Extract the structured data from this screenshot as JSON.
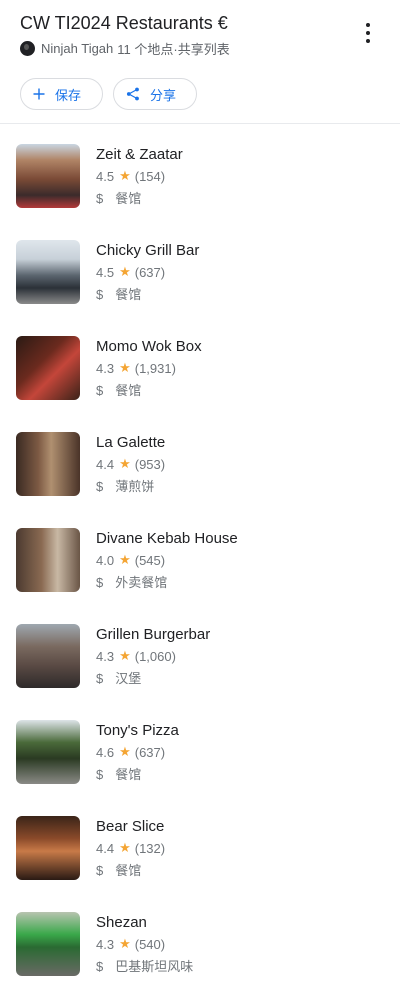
{
  "header": {
    "title": "CW TI2024 Restaurants €",
    "owner": "Ninjah Tigah",
    "meta": "11 个地点·共享列表",
    "save_label": "保存",
    "share_label": "分享"
  },
  "colors": {
    "accent": "#1a73e8",
    "star": "#f4a534"
  },
  "places": [
    {
      "name": "Zeit & Zaatar",
      "rating": "4.5",
      "reviews": "(154)",
      "price": "$",
      "category": "餐馆"
    },
    {
      "name": "Chicky Grill Bar",
      "rating": "4.5",
      "reviews": "(637)",
      "price": "$",
      "category": "餐馆"
    },
    {
      "name": "Momo Wok Box",
      "rating": "4.3",
      "reviews": "(1,931)",
      "price": "$",
      "category": "餐馆"
    },
    {
      "name": "La Galette",
      "rating": "4.4",
      "reviews": "(953)",
      "price": "$",
      "category": "薄煎饼"
    },
    {
      "name": "Divane Kebab House",
      "rating": "4.0",
      "reviews": "(545)",
      "price": "$",
      "category": "外卖餐馆"
    },
    {
      "name": "Grillen Burgerbar",
      "rating": "4.3",
      "reviews": "(1,060)",
      "price": "$",
      "category": "汉堡"
    },
    {
      "name": "Tony's Pizza",
      "rating": "4.6",
      "reviews": "(637)",
      "price": "$",
      "category": "餐馆"
    },
    {
      "name": "Bear Slice",
      "rating": "4.4",
      "reviews": "(132)",
      "price": "$",
      "category": "餐馆"
    },
    {
      "name": "Shezan",
      "rating": "4.3",
      "reviews": "(540)",
      "price": "$",
      "category": "巴基斯坦风味"
    }
  ]
}
